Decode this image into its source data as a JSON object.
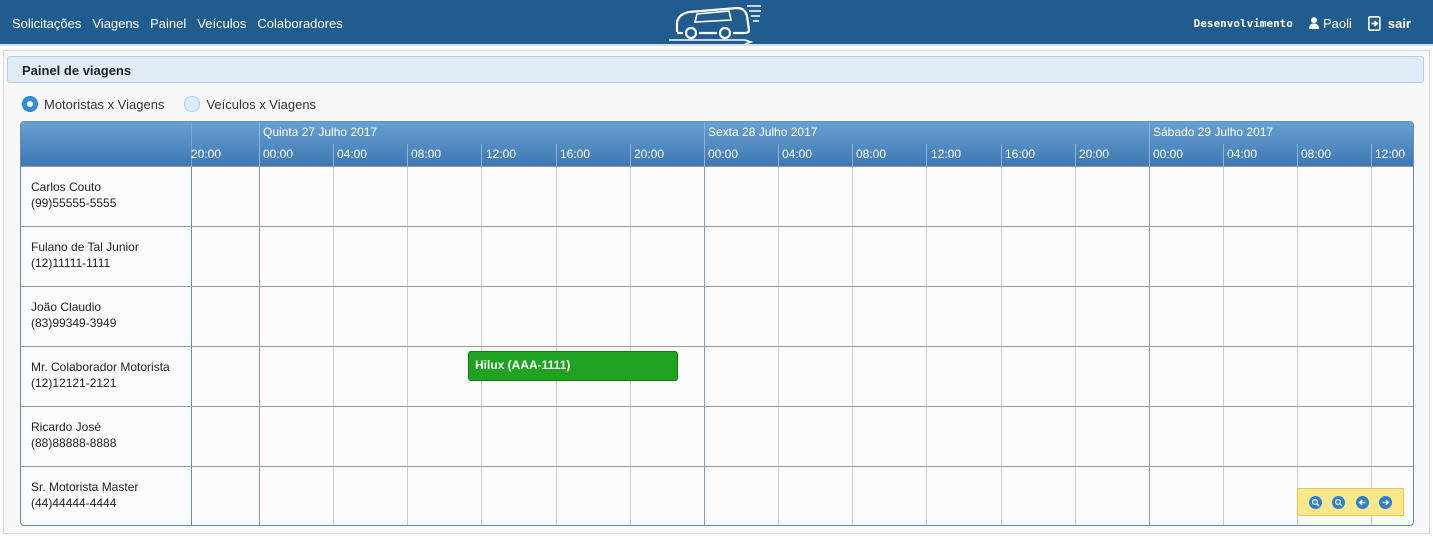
{
  "nav": {
    "links": [
      "Solicitações",
      "Viagens",
      "Painel",
      "Veículos",
      "Colaboradores"
    ],
    "environment": "Desenvolvimento",
    "user": "Paoli",
    "logout": "sair"
  },
  "panel": {
    "title": "Painel de viagens"
  },
  "view_options": [
    {
      "label": "Motoristas x Viagens",
      "selected": true
    },
    {
      "label": "Veículos x Viagens",
      "selected": false
    }
  ],
  "timeline": {
    "days": [
      "Quinta 27 Julho 2017",
      "Sexta 28 Julho 2017",
      "Sábado 29 Julho 2017"
    ],
    "hours": [
      "20:00",
      "00:00",
      "04:00",
      "08:00",
      "12:00",
      "16:00",
      "20:00",
      "00:00",
      "04:00",
      "08:00",
      "12:00",
      "16:00",
      "20:00",
      "00:00",
      "04:00",
      "08:00",
      "12:00"
    ],
    "drivers": [
      {
        "name": "Carlos Couto",
        "phone": "(99)55555-5555"
      },
      {
        "name": "Fulano de Tal Junior",
        "phone": "(12)11111-1111"
      },
      {
        "name": "João Claudio",
        "phone": "(83)99349-3949"
      },
      {
        "name": "Mr. Colaborador Motorista",
        "phone": "(12)12121-2121"
      },
      {
        "name": "Ricardo José",
        "phone": "(88)88888-8888"
      },
      {
        "name": "Sr. Motorista Master",
        "phone": "(44)44444-4444"
      }
    ],
    "event": {
      "label": "Hilux (AAA-1111)",
      "color": "#1fa21f"
    }
  },
  "controls": [
    "zoom-in-icon",
    "zoom-out-icon",
    "arrow-left-icon",
    "arrow-right-icon"
  ],
  "colors": {
    "navbar": "#215c8f",
    "header": "#4a84bd",
    "event": "#1fa21f",
    "nav_box": "#fbe88a"
  }
}
